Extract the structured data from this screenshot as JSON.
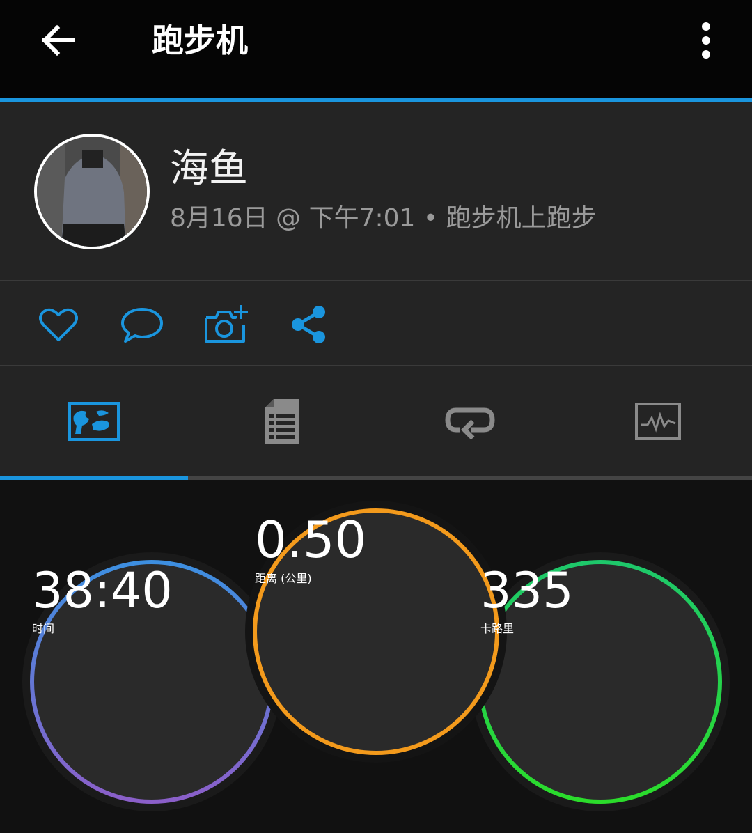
{
  "header": {
    "title": "跑步机",
    "back_icon": "arrow-left-icon",
    "menu_icon": "more-vertical-icon"
  },
  "profile": {
    "name": "海鱼",
    "meta": "8月16日 @ 下午7:01 • 跑步机上跑步"
  },
  "actions": [
    {
      "icon": "heart-icon"
    },
    {
      "icon": "comment-icon"
    },
    {
      "icon": "add-photo-icon"
    },
    {
      "icon": "share-icon"
    }
  ],
  "tabs": [
    {
      "icon": "map-icon",
      "active": true
    },
    {
      "icon": "document-icon",
      "active": false
    },
    {
      "icon": "laps-icon",
      "active": false
    },
    {
      "icon": "chart-icon",
      "active": false
    }
  ],
  "stats": {
    "time": {
      "value": "38:40",
      "label": "时间"
    },
    "distance": {
      "value": "0.50",
      "label": "距离 (公里)"
    },
    "calories": {
      "value": "335",
      "label": "卡路里"
    }
  },
  "colors": {
    "accent": "#1a95de",
    "time_ring_start": "#3d8fe0",
    "time_ring_end": "#8b5fc9",
    "distance_ring": "#f39a1c",
    "calories_ring_start": "#1ec86b",
    "calories_ring_end": "#2bdc2b"
  }
}
